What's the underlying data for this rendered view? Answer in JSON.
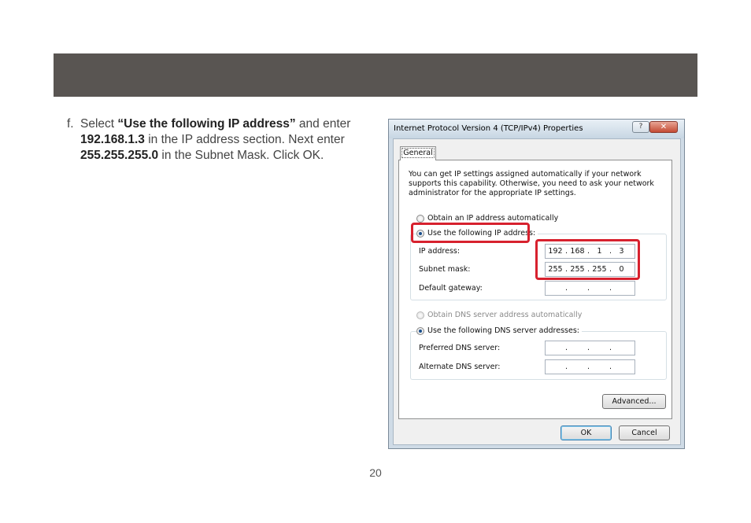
{
  "instruction": {
    "step": "f.",
    "parts": {
      "p1": "Select ",
      "b1": "“Use the following IP address”",
      "p2": " and enter ",
      "b2": "192.168.1.3",
      "p3": " in the IP address section. Next enter ",
      "b3": "255.255.255.0",
      "p4": " in the Subnet Mask. Click OK."
    }
  },
  "page_number": "20",
  "dialog": {
    "title": "Internet Protocol Version 4 (TCP/IPv4) Properties",
    "help_label": "?",
    "close_label": "✕",
    "tab": "General",
    "description": "You can get IP settings assigned automatically if your network supports this capability. Otherwise, you need to ask your network administrator for the appropriate IP settings.",
    "radio_auto_ip": "Obtain an IP address automatically",
    "radio_static_ip": "Use the following IP address:",
    "ip_label": "IP address:",
    "ip_value": [
      "192",
      "168",
      "1",
      "3"
    ],
    "subnet_label": "Subnet mask:",
    "subnet_value": [
      "255",
      "255",
      "255",
      "0"
    ],
    "gateway_label": "Default gateway:",
    "radio_auto_dns": "Obtain DNS server address automatically",
    "radio_static_dns": "Use the following DNS server addresses:",
    "preferred_dns_label": "Preferred DNS server:",
    "alternate_dns_label": "Alternate DNS server:",
    "advanced_label": "Advanced...",
    "ok_label": "OK",
    "cancel_label": "Cancel",
    "highlight_color": "#d7212e"
  }
}
